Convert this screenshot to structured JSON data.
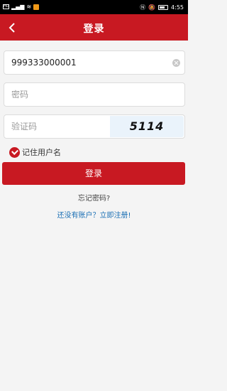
{
  "status_bar": {
    "left_label": "HD",
    "time": "4:55",
    "battery": "55"
  },
  "header": {
    "title": "登录"
  },
  "form": {
    "username_value": "999333000001",
    "password_placeholder": "密码",
    "captcha_placeholder": "验证码",
    "captcha_code": "5114"
  },
  "remember": {
    "label": "记住用户名",
    "checked": true
  },
  "buttons": {
    "login": "登录"
  },
  "links": {
    "forgot": "忘记密码?",
    "register": "还没有账户？立即注册!"
  },
  "colors": {
    "brand": "#c81922",
    "link": "#1a6fb4"
  }
}
